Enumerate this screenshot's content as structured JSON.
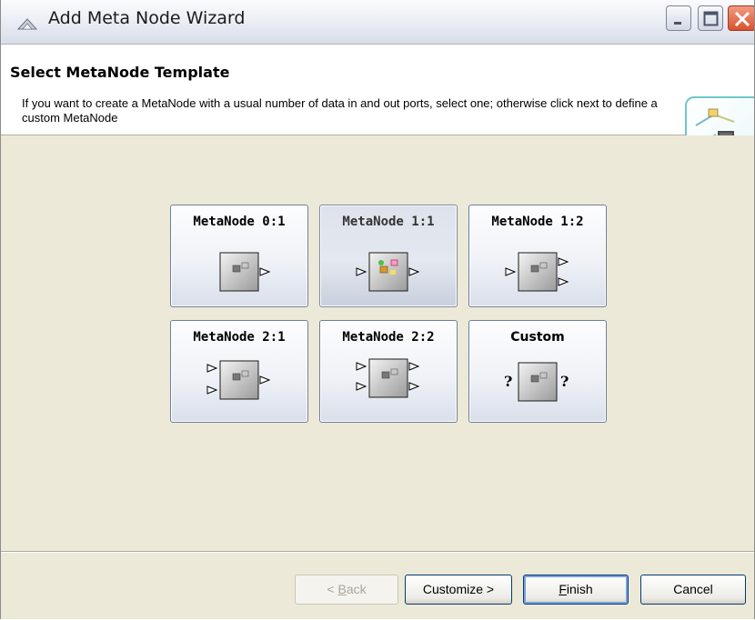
{
  "window": {
    "title": "Add Meta Node Wizard",
    "icon": "knime-wizard-icon",
    "controls": {
      "minimize": "minimize-icon",
      "maximize": "maximize-icon",
      "close": "close-icon"
    },
    "colors": {
      "close": "#d9532f",
      "frame_border": "#7c8496"
    }
  },
  "header": {
    "title": "Select MetaNode Template",
    "description": "If you want to create a MetaNode with a usual number of data in and out ports, select one; otherwise click next to define a custom MetaNode",
    "image": "metanode-wizard-graphic"
  },
  "templates": [
    {
      "label": "MetaNode 0:1",
      "inputs": 0,
      "outputs": 1,
      "selected": false
    },
    {
      "label": "MetaNode 1:1",
      "inputs": 1,
      "outputs": 1,
      "selected": true
    },
    {
      "label": "MetaNode 1:2",
      "inputs": 1,
      "outputs": 2,
      "selected": false
    },
    {
      "label": "MetaNode 2:1",
      "inputs": 2,
      "outputs": 1,
      "selected": false
    },
    {
      "label": "MetaNode 2:2",
      "inputs": 2,
      "outputs": 2,
      "selected": false
    },
    {
      "label": "Custom",
      "inputs": "?",
      "outputs": "?",
      "selected": false
    }
  ],
  "buttons": {
    "back": {
      "prefix": "< ",
      "mnemonic": "B",
      "rest": "ack",
      "enabled": false
    },
    "customize": {
      "label": "Customize >",
      "enabled": true
    },
    "finish": {
      "mnemonic": "F",
      "rest": "inish",
      "enabled": true,
      "default": true
    },
    "cancel": {
      "label": "Cancel",
      "enabled": true
    }
  }
}
